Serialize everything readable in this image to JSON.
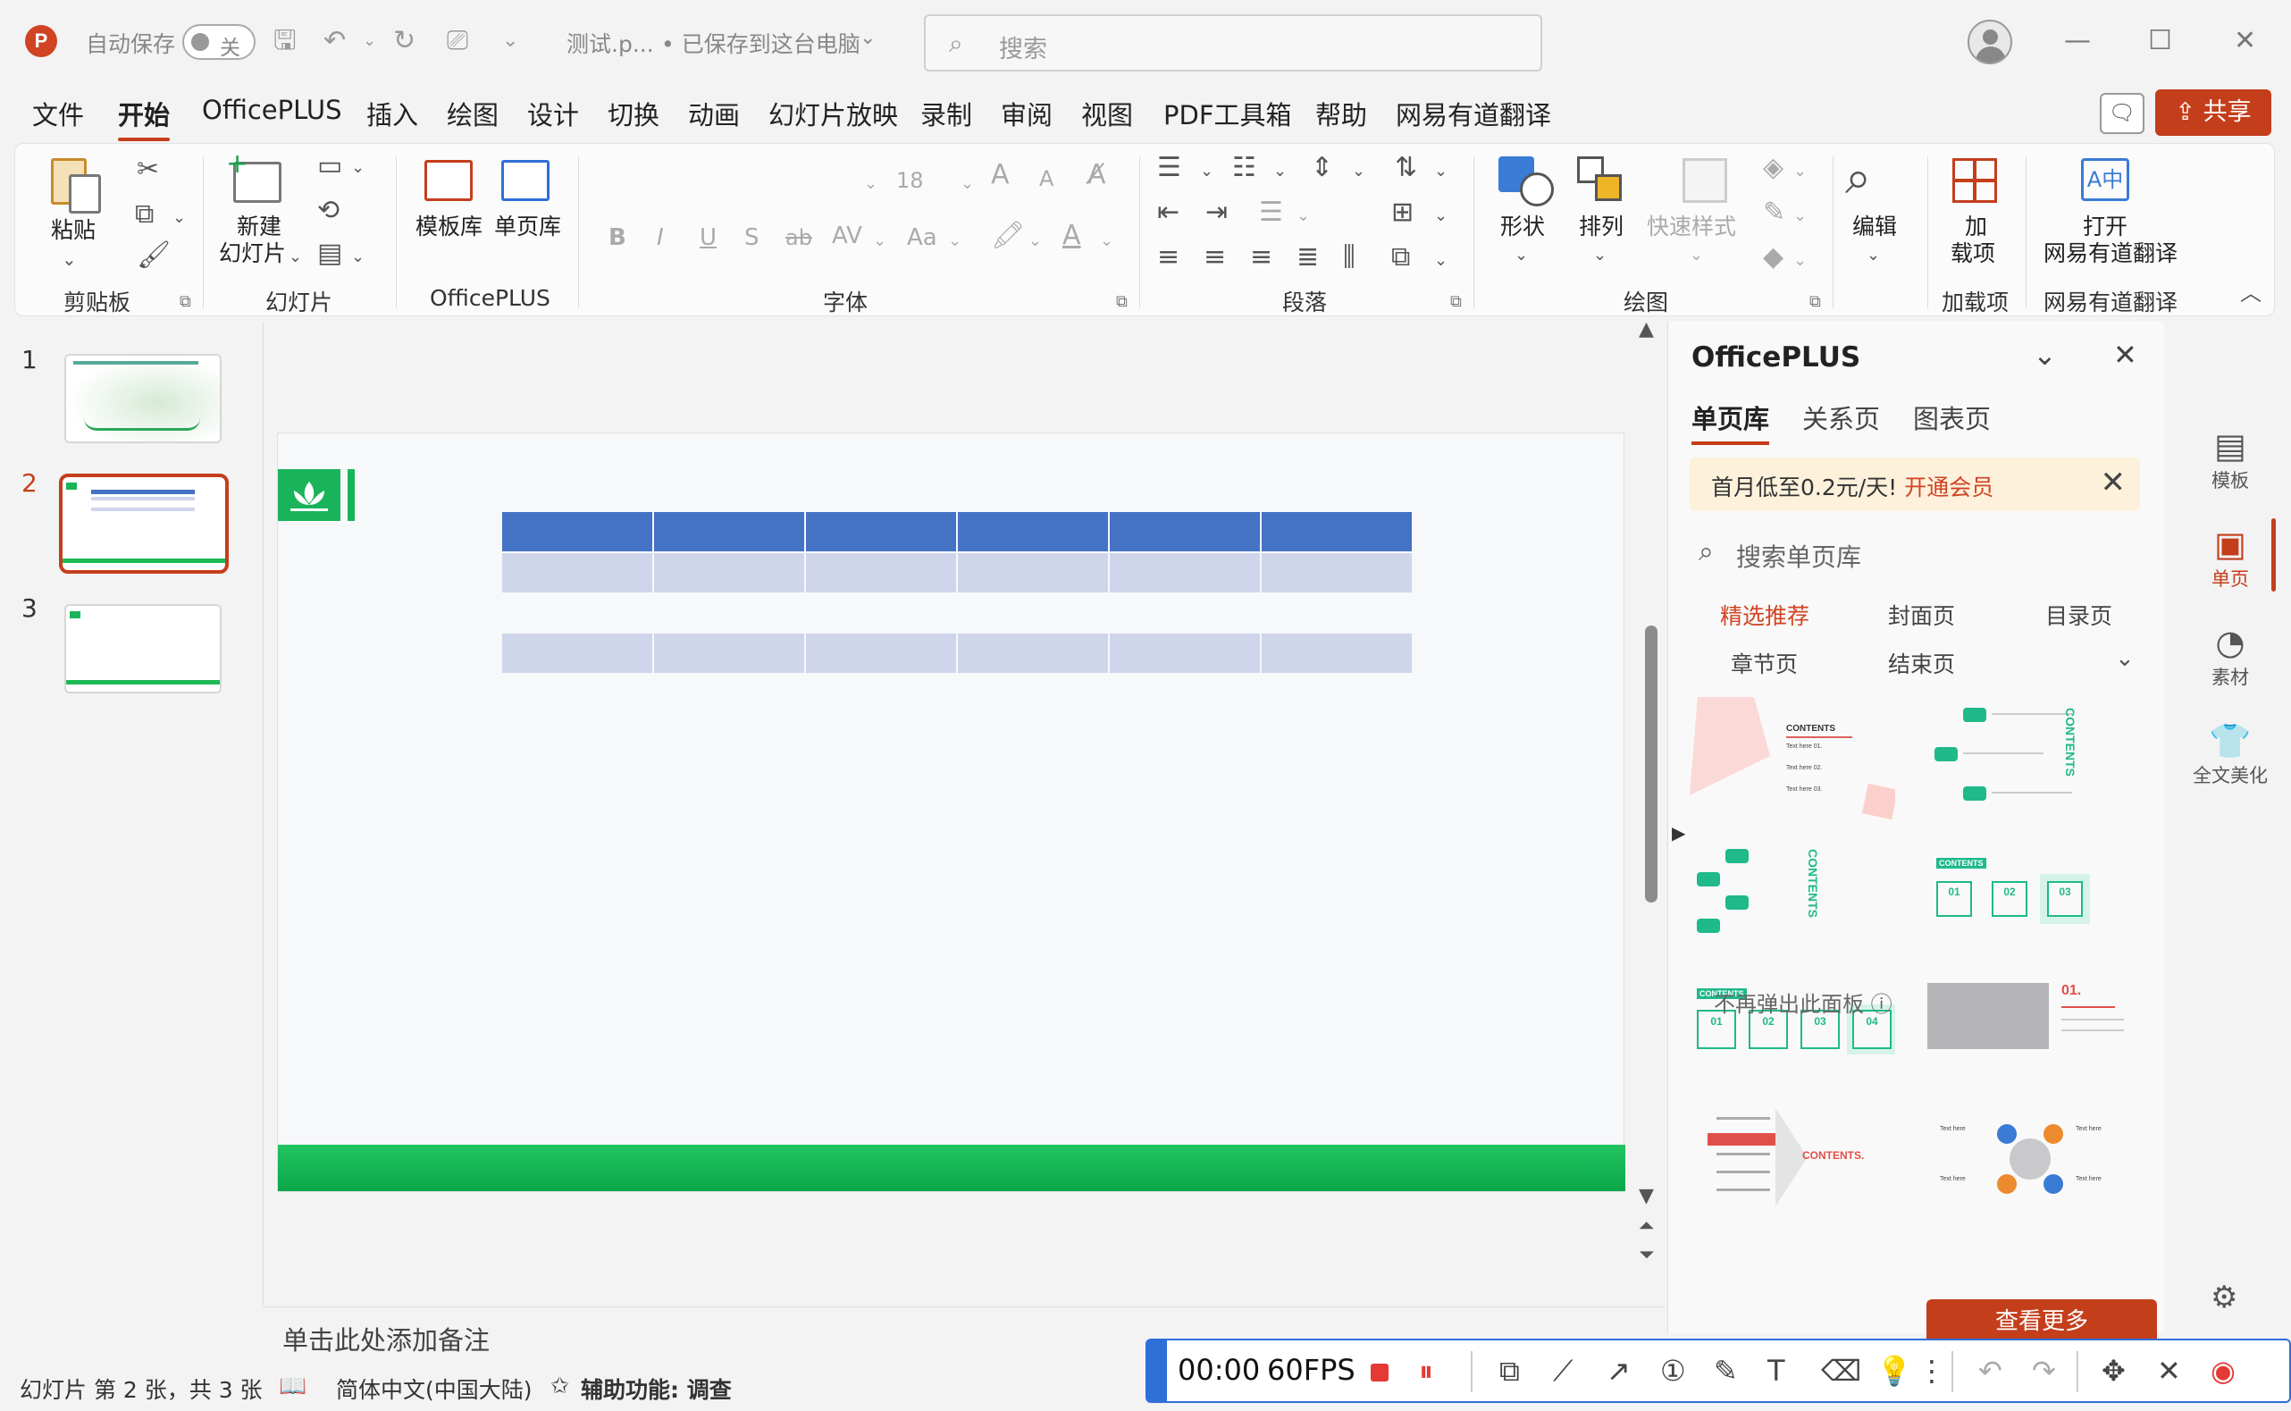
{
  "titlebar": {
    "app_icon": "P",
    "autosave_label": "自动保存",
    "autosave_state": "关",
    "doc_name": "测试.p...",
    "save_status": "• 已保存到这台电脑",
    "search_placeholder": "搜索"
  },
  "menu": {
    "tabs": [
      "文件",
      "开始",
      "OfficePLUS",
      "插入",
      "绘图",
      "设计",
      "切换",
      "动画",
      "幻灯片放映",
      "录制",
      "审阅",
      "视图",
      "PDF工具箱",
      "帮助",
      "网易有道翻译"
    ],
    "active_index": 1,
    "share_label": "共享"
  },
  "ribbon": {
    "clipboard": {
      "paste": "粘贴",
      "group": "剪贴板"
    },
    "slides": {
      "new_slide_line1": "新建",
      "new_slide_line2": "幻灯片",
      "group": "幻灯片"
    },
    "officeplus": {
      "template_lib": "模板库",
      "page_lib": "单页库",
      "group": "OfficePLUS"
    },
    "font": {
      "size": "18",
      "group": "字体",
      "bold": "B",
      "italic": "I",
      "underline": "U",
      "strike_s": "S",
      "abc": "ab",
      "spacing": "AV",
      "case": "Aa",
      "grow": "A",
      "shrink": "A"
    },
    "paragraph": {
      "group": "段落"
    },
    "drawing": {
      "shape": "形状",
      "arrange": "排列",
      "quick_style": "快速样式",
      "group": "绘图"
    },
    "editing": {
      "edit": "编辑"
    },
    "addins": {
      "line1": "加",
      "line2": "载项",
      "group": "加载项"
    },
    "youdao": {
      "line1": "打开",
      "line2": "网易有道翻译",
      "group": "网易有道翻译"
    }
  },
  "thumbnails": [
    {
      "num": "1",
      "selected": false
    },
    {
      "num": "2",
      "selected": true
    },
    {
      "num": "3",
      "selected": false
    }
  ],
  "notes_placeholder": "单击此处添加备注",
  "panel": {
    "title": "OfficePLUS",
    "tabs": [
      "单页库",
      "关系页",
      "图表页"
    ],
    "active_tab": 0,
    "promo_text": "首月低至0.2元/天!",
    "promo_link": "开通会员",
    "search_placeholder": "搜索单页库",
    "categories": [
      "精选推荐",
      "封面页",
      "目录页",
      "章节页",
      "结束页"
    ],
    "active_category": 0,
    "card_text": {
      "contents": "CONTENTS",
      "contents_dot": "CONTENTS.",
      "text_here_1": "Text here 01.",
      "text_here_2": "Text here 02.",
      "text_here_3": "Text here 03.",
      "num_01": "01",
      "num_02": "02",
      "num_03": "03",
      "num_04": "04",
      "num_01_dot": "01.",
      "text_here": "Text here"
    },
    "footer_text": "不再弹出此面板",
    "more_button": "查看更多",
    "side_items": [
      {
        "label": "模板",
        "icon": "template-icon"
      },
      {
        "label": "单页",
        "icon": "single-page-icon"
      },
      {
        "label": "素材",
        "icon": "material-icon"
      },
      {
        "label": "全文美化",
        "icon": "beautify-icon"
      }
    ],
    "active_side": 1
  },
  "status": {
    "slide_info": "幻灯片 第 2 张，共 3 张",
    "language": "简体中文(中国大陆)",
    "accessibility": "辅助功能: 调查"
  },
  "recorder": {
    "time": "00:00",
    "fps": "60FPS"
  },
  "colors": {
    "accent": "#c43e1c",
    "table_header": "#4472c4",
    "table_body": "#cfd5ea",
    "green": "#19b45a",
    "recorder_blue": "#2f6fd8"
  }
}
